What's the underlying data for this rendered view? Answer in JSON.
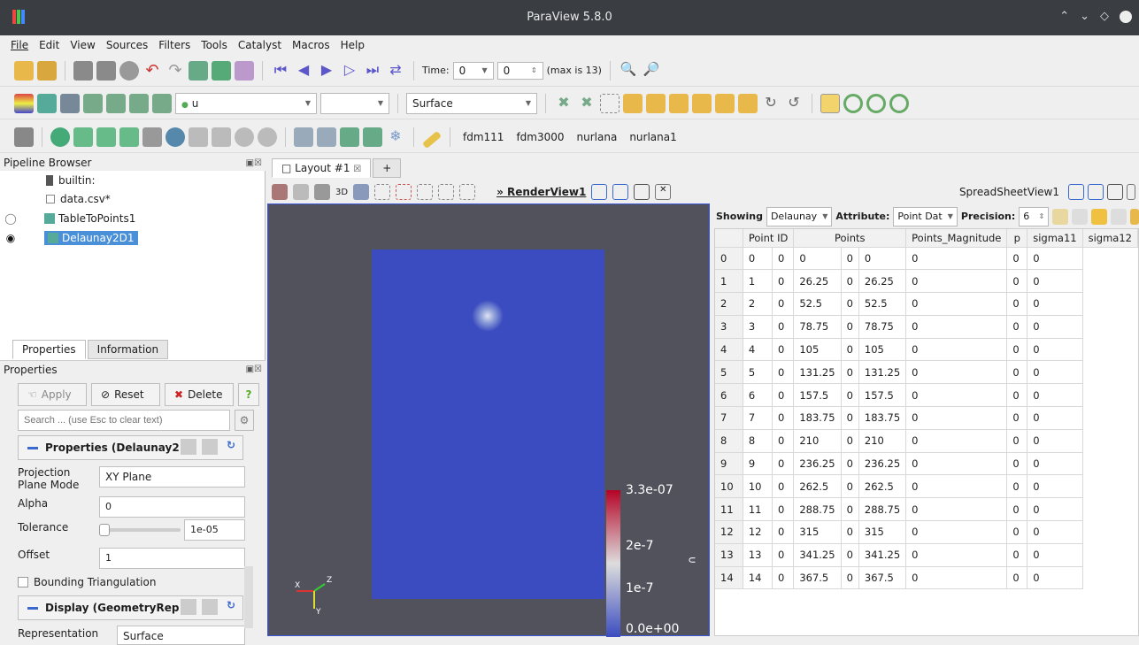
{
  "window": {
    "title": "ParaView 5.8.0"
  },
  "menu": [
    "File",
    "Edit",
    "View",
    "Sources",
    "Filters",
    "Tools",
    "Catalyst",
    "Macros",
    "Help"
  ],
  "time_toolbar": {
    "label": "Time:",
    "value": "0",
    "step": "0",
    "max": "(max is 13)"
  },
  "variable_toolbar": {
    "array": "u",
    "component": "",
    "representation": "Surface"
  },
  "custom_filters": [
    "fdm111",
    "fdm3000",
    "nurlana",
    "nurlana1"
  ],
  "pipeline_browser": {
    "title": "Pipeline Browser",
    "items": [
      {
        "label": "builtin:"
      },
      {
        "label": "data.csv*"
      },
      {
        "label": "TableToPoints1"
      },
      {
        "label": "Delaunay2D1"
      }
    ]
  },
  "properties_panel": {
    "tabs": [
      "Properties",
      "Information"
    ],
    "title": "Properties",
    "apply": "Apply",
    "reset": "Reset",
    "delete": "Delete",
    "help": "?",
    "search_placeholder": "Search ... (use Esc to clear text)",
    "section1": "Properties (Delaunay2",
    "projection_label": "Projection Plane Mode",
    "projection_value": "XY Plane",
    "alpha_label": "Alpha",
    "alpha_value": "0",
    "tolerance_label": "Tolerance",
    "tolerance_value": "1e-05",
    "offset_label": "Offset",
    "offset_value": "1",
    "bounding_label": "Bounding Triangulation",
    "section2": "Display (GeometryRep",
    "representation_label": "Representation",
    "representation_value": "Surface"
  },
  "layout": {
    "tab": "Layout #1",
    "add": "+",
    "render_view": "RenderView1",
    "spreadsheet_view": "SpreadSheetView1",
    "mode_3d": "3D"
  },
  "colorbar": {
    "labels": [
      "3.3e-07",
      "2e-7",
      "1e-7",
      "0.0e+00"
    ],
    "colors": {
      "top": "#b40426",
      "mid": "#dddddd",
      "bottom": "#3b4cc0"
    }
  },
  "axes": {
    "x": "X",
    "y": "Y",
    "z": "Z"
  },
  "spreadsheet": {
    "showing_label": "Showing",
    "showing_value": "Delaunay",
    "attribute_label": "Attribute:",
    "attribute_value": "Point Dat",
    "precision_label": "Precision:",
    "precision_value": "6",
    "columns": [
      "Point ID",
      "Points",
      "Points_Magnitude",
      "p",
      "sigma11",
      "sigma12"
    ],
    "rows": [
      [
        "0",
        "0",
        "0",
        "0",
        "0",
        "0",
        "0",
        "0",
        "0",
        "0"
      ],
      [
        "1",
        "1",
        "0",
        "26.25",
        "0",
        "26.25",
        "0",
        "0",
        "0"
      ],
      [
        "2",
        "2",
        "0",
        "52.5",
        "0",
        "52.5",
        "0",
        "0",
        "0"
      ],
      [
        "3",
        "3",
        "0",
        "78.75",
        "0",
        "78.75",
        "0",
        "0",
        "0"
      ],
      [
        "4",
        "4",
        "0",
        "105",
        "0",
        "105",
        "0",
        "0",
        "0"
      ],
      [
        "5",
        "5",
        "0",
        "131.25",
        "0",
        "131.25",
        "0",
        "0",
        "0"
      ],
      [
        "6",
        "6",
        "0",
        "157.5",
        "0",
        "157.5",
        "0",
        "0",
        "0"
      ],
      [
        "7",
        "7",
        "0",
        "183.75",
        "0",
        "183.75",
        "0",
        "0",
        "0"
      ],
      [
        "8",
        "8",
        "0",
        "210",
        "0",
        "210",
        "0",
        "0",
        "0"
      ],
      [
        "9",
        "9",
        "0",
        "236.25",
        "0",
        "236.25",
        "0",
        "0",
        "0"
      ],
      [
        "10",
        "10",
        "0",
        "262.5",
        "0",
        "262.5",
        "0",
        "0",
        "0"
      ],
      [
        "11",
        "11",
        "0",
        "288.75",
        "0",
        "288.75",
        "0",
        "0",
        "0"
      ],
      [
        "12",
        "12",
        "0",
        "315",
        "0",
        "315",
        "0",
        "0",
        "0"
      ],
      [
        "13",
        "13",
        "0",
        "341.25",
        "0",
        "341.25",
        "0",
        "0",
        "0"
      ],
      [
        "14",
        "14",
        "0",
        "367.5",
        "0",
        "367.5",
        "0",
        "0",
        "0"
      ]
    ]
  }
}
